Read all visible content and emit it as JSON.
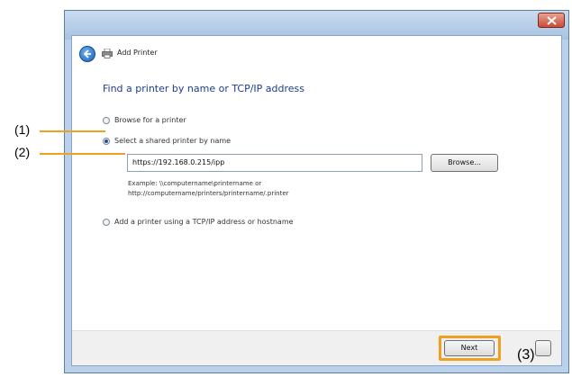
{
  "window": {
    "title": "Add Printer"
  },
  "page": {
    "heading": "Find a printer by name or TCP/IP address",
    "options": [
      {
        "label": "Browse for a printer",
        "selected": false
      },
      {
        "label": "Select a shared printer by name",
        "selected": true
      },
      {
        "label": "Add a printer using a TCP/IP address or hostname",
        "selected": false
      }
    ],
    "shared_printer_value": "https://192.168.0.215/ipp",
    "browse_label": "Browse...",
    "example_line1": "Example: \\\\computername\\printername or",
    "example_line2": "http://computername/printers/printername/.printer"
  },
  "footer": {
    "next_label": "Next"
  },
  "callouts": {
    "c1": "(1)",
    "c2": "(2)",
    "c3": "(3)"
  },
  "colors": {
    "highlight": "#f0a020",
    "heading": "#1e3c8c"
  }
}
